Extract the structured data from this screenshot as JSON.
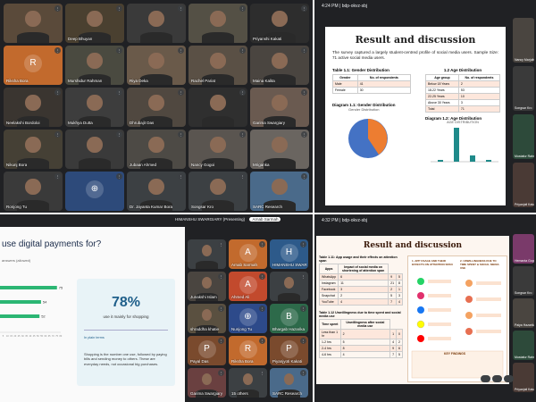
{
  "q1": {
    "tiles": [
      {
        "name": "",
        "bg": "#5a4a3a"
      },
      {
        "name": "Deep Bhuyan",
        "bg": "#4a4030"
      },
      {
        "name": "",
        "bg": "#3a3a3a"
      },
      {
        "name": "",
        "bg": "#545045"
      },
      {
        "name": "Priyanshi Kakati",
        "bg": "#2d2d2d"
      },
      {
        "name": "Riksha Bora",
        "bg": "#c26a2d",
        "avatar": "R"
      },
      {
        "name": "Murshidur Rahman",
        "bg": "#4a4a40"
      },
      {
        "name": "Riya Deka",
        "bg": "#6a5a4a"
      },
      {
        "name": "Rachel Pariat",
        "bg": "#5a5045"
      },
      {
        "name": "Maina Kalita",
        "bg": "#4a4540"
      },
      {
        "name": "Neelakshi Bordoloi",
        "bg": "#3a3530"
      },
      {
        "name": "Mukhya Dutta",
        "bg": "#3d3d3d"
      },
      {
        "name": "Dhrubajit Das",
        "bg": "#504840"
      },
      {
        "name": "",
        "bg": "#2f2f2f"
      },
      {
        "name": "Garima Swargiary",
        "bg": "#6a5a50"
      },
      {
        "name": "Nikunj Bora",
        "bg": "#454035"
      },
      {
        "name": "",
        "bg": "#3a3a3a"
      },
      {
        "name": "Jubaan Ahmed",
        "bg": "#4d4a45"
      },
      {
        "name": "Nancy Gogoi",
        "bg": "#5a5550"
      },
      {
        "name": "Mriganka",
        "bg": "#6a6560"
      },
      {
        "name": "Ronjong Tu",
        "bg": "#3a3a3a"
      },
      {
        "name": "",
        "bg": "#2d4a7a",
        "avatar": "⊕"
      },
      {
        "name": "Dr. Jayanta Kumar Bora",
        "bg": "#3c4043"
      },
      {
        "name": "Songsar Kro",
        "bg": "#3c4043"
      },
      {
        "name": "SARC Research",
        "bg": "#4a6a8a"
      }
    ]
  },
  "q2": {
    "time": "4:24 PM",
    "meet_code": "bdp-okvz-sbj",
    "title": "Result and discussion",
    "intro": "The survey captured a largely student-centred profile of social media users. Sample Size: 71 active social media users.",
    "table1_title": "Table 1.1: Gender Distribution",
    "table1_headers": [
      "Gender",
      "No. of respondents"
    ],
    "table1_rows": [
      [
        "Male",
        "41"
      ],
      [
        "Female",
        "30"
      ]
    ],
    "table2_title": "1.2 Age Distribution",
    "table2_headers": [
      "Age group",
      "No. of respondents"
    ],
    "table2_rows": [
      [
        "Below 18 Years",
        "2"
      ],
      [
        "18-22 Years",
        "53"
      ],
      [
        "22-25 Years",
        "10"
      ],
      [
        "Above 30 Years",
        "3"
      ],
      [
        "Total",
        "71"
      ]
    ],
    "diagram1_title": "Diagram 1.1: Gender Distribution",
    "diagram1_sub": "Gender Distribution",
    "diagram2_title": "Diagram 1.2: Age Distribution",
    "diagram2_sub": "AGE DISTRIBUTION",
    "side_names": [
      "Nancy Marjulina",
      "Songsar Kro",
      "Mustafur Rahman",
      "Priyanjali Kakati"
    ]
  },
  "q3": {
    "presenter": "HIMANSHU SWARGIARY (Presenting)",
    "presenter_badge": "Arnab Sarmah",
    "question": "use digital payments for?",
    "answers_note": "answers (allowed)",
    "bars": [
      {
        "value": 75,
        "label": "75"
      },
      {
        "value": 54,
        "label": "54"
      },
      {
        "value": 52,
        "label": "52"
      }
    ],
    "axis_ticks": [
      "5",
      "10",
      "15",
      "20",
      "25",
      "30",
      "35",
      "40",
      "45",
      "50",
      "55",
      "60",
      "65",
      "70",
      "75",
      "80"
    ],
    "stat_value": "78%",
    "stat_label": "use it mainly for shopping",
    "insight_title": "In plain terms",
    "insight_text": "Shopping is the number one use, followed by paying bills and sending money to others. These are everyday needs, not occasional big purchases.",
    "side_tiles": [
      {
        "name": "",
        "bg": "#3c4043"
      },
      {
        "name": "Arnab Sarmah",
        "bg": "#c26a2d",
        "avatar": "A"
      },
      {
        "name": "HIMANSHU SWAR...",
        "bg": "#2d5a8a",
        "avatar": "H"
      },
      {
        "name": "Junakshi Islam",
        "bg": "#4a4540"
      },
      {
        "name": "Ahmed Ali",
        "bg": "#c24a2d",
        "avatar": "A"
      },
      {
        "name": "",
        "bg": "#3c4043"
      },
      {
        "name": "shraddha khatie",
        "bg": "#5a5040"
      },
      {
        "name": "Nunjong Tu",
        "bg": "#2d4a8a",
        "avatar": "⊕"
      },
      {
        "name": "Bhargab Hazarika",
        "bg": "#2d6a4a",
        "avatar": "B"
      },
      {
        "name": "Payal Das",
        "bg": "#7a4a2d",
        "avatar": "P"
      },
      {
        "name": "Riksha Bora",
        "bg": "#c26a2d",
        "avatar": "R"
      },
      {
        "name": "Piyanjyoti Kakati",
        "bg": "#7a4a2d",
        "avatar": "P"
      },
      {
        "name": "Garima Swargiary",
        "bg": "#6a4040"
      },
      {
        "name": "15 others",
        "bg": "#3c4043"
      },
      {
        "name": "SARC Research",
        "bg": "#4a6a8a"
      }
    ]
  },
  "q4": {
    "time": "4:32 PM",
    "meet_code": "bdp-okvz-sbj",
    "title": "Result and discussion",
    "table1_title": "Table 1.11: App usage and their effects on attention span",
    "table1_headers": [
      "Apps",
      "Impact of social media on shortening of attention span"
    ],
    "table1_rows": [
      [
        "WhatsApp",
        "6",
        "9",
        "5"
      ],
      [
        "Instagram",
        "11",
        "21",
        "8"
      ],
      [
        "Facebook",
        "3",
        "2",
        "1"
      ],
      [
        "Snapchat",
        "2",
        "5",
        "3"
      ],
      [
        "YouTube",
        "4",
        "7",
        "4"
      ]
    ],
    "table2_title": "Table 1.12 Unwillingness due to time spent and social media use",
    "table2_headers": [
      "Time spent",
      "Unwillingness after social media use"
    ],
    "table2_rows": [
      [
        "Less than 1 hr",
        "2",
        "1",
        "0"
      ],
      [
        "1-2 hrs",
        "5",
        "4",
        "2"
      ],
      [
        "2-4 hrs",
        "8",
        "9",
        "6"
      ],
      [
        "4-6 hrs",
        "4",
        "7",
        "5"
      ]
    ],
    "infographic_left": "1. APP USAGE AND THEIR EFFECTS ON ATTENTION SPAN",
    "infographic_right": "2. UNWILLINGNESS DUE TO TIME SPENT & SOCIAL MEDIA USE",
    "findings_label": "KEY FINDINGS",
    "side_names": [
      "Hemanta Gogoi",
      "Songsar Kro",
      "Paiya Hazarika",
      "Mustafur Rahman",
      "Priyanjali Kakati"
    ]
  }
}
